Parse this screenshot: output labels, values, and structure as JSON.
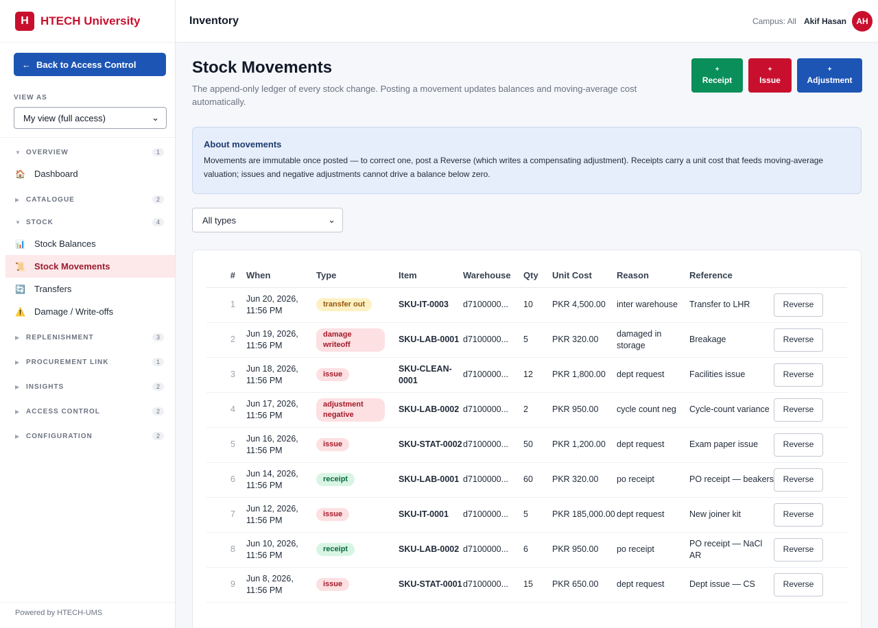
{
  "brand": {
    "logo_letter": "H",
    "name": "HTECH University",
    "color": "#c8102e"
  },
  "sidebar": {
    "back_label": "Back to Access Control",
    "view_as_label": "VIEW AS",
    "view_as_value": "My view (full access)",
    "groups": [
      {
        "name": "OVERVIEW",
        "count": "1",
        "expanded": true,
        "items": [
          {
            "icon": "house-icon",
            "label": "Dashboard"
          }
        ]
      },
      {
        "name": "CATALOGUE",
        "count": "2",
        "expanded": false
      },
      {
        "name": "STOCK",
        "count": "4",
        "expanded": true,
        "items": [
          {
            "icon": "bar-chart-icon",
            "label": "Stock Balances"
          },
          {
            "icon": "scroll-icon",
            "label": "Stock Movements",
            "active": true
          },
          {
            "icon": "transfer-icon",
            "label": "Transfers"
          },
          {
            "icon": "warning-icon",
            "label": "Damage / Write-offs"
          }
        ]
      },
      {
        "name": "REPLENISHMENT",
        "count": "3",
        "expanded": false
      },
      {
        "name": "PROCUREMENT LINK",
        "count": "1",
        "expanded": false
      },
      {
        "name": "INSIGHTS",
        "count": "2",
        "expanded": false
      },
      {
        "name": "ACCESS CONTROL",
        "count": "2",
        "expanded": false
      },
      {
        "name": "CONFIGURATION",
        "count": "2",
        "expanded": false
      }
    ],
    "powered_by": "Powered by HTECH-UMS"
  },
  "topbar": {
    "title": "Inventory",
    "campus": "Campus: All",
    "user_name": "Akif Hasan",
    "avatar_initials": "AH"
  },
  "page": {
    "title": "Stock Movements",
    "subtitle": "The append-only ledger of every stock change. Posting a movement updates balances and moving-average cost automatically.",
    "actions": [
      {
        "plus": "+",
        "label": "Receipt",
        "color": "#0a8f5a"
      },
      {
        "plus": "+",
        "label": "Issue",
        "color": "#c8102e"
      },
      {
        "plus": "+",
        "label": "Adjustment",
        "color": "#1d55b4"
      }
    ],
    "info": {
      "title": "About movements",
      "text": "Movements are immutable once posted — to correct one, post a Reverse (which writes a compensating adjustment). Receipts carry a unit cost that feeds moving-average valuation; issues and negative adjustments cannot drive a balance below zero."
    },
    "filter_value": "All types"
  },
  "table": {
    "headers": [
      "#",
      "When",
      "Type",
      "Item",
      "Warehouse",
      "Qty",
      "Unit Cost",
      "Reason",
      "Reference",
      ""
    ],
    "reverse_label": "Reverse",
    "rows": [
      {
        "n": "1",
        "when": "Jun 20, 2026, 11:56 PM",
        "type": "transfer out",
        "tclass": "b-transfer",
        "item": "SKU-IT-0003",
        "wh": "d7100000...",
        "qty": "10",
        "cost": "PKR 4,500.00",
        "reason": "inter warehouse",
        "ref": "Transfer to LHR"
      },
      {
        "n": "2",
        "when": "Jun 19, 2026, 11:56 PM",
        "type": "damage writeoff",
        "tclass": "b-damage b-wide",
        "item": "SKU-LAB-0001",
        "wh": "d7100000...",
        "qty": "5",
        "cost": "PKR 320.00",
        "reason": "damaged in storage",
        "ref": "Breakage"
      },
      {
        "n": "3",
        "when": "Jun 18, 2026, 11:56 PM",
        "type": "issue",
        "tclass": "b-issue",
        "item": "SKU-CLEAN-0001",
        "wh": "d7100000...",
        "qty": "12",
        "cost": "PKR 1,800.00",
        "reason": "dept request",
        "ref": "Facilities issue"
      },
      {
        "n": "4",
        "when": "Jun 17, 2026, 11:56 PM",
        "type": "adjustment negative",
        "tclass": "b-adjust b-wide",
        "item": "SKU-LAB-0002",
        "wh": "d7100000...",
        "qty": "2",
        "cost": "PKR 950.00",
        "reason": "cycle count neg",
        "ref": "Cycle-count variance"
      },
      {
        "n": "5",
        "when": "Jun 16, 2026, 11:56 PM",
        "type": "issue",
        "tclass": "b-issue",
        "item": "SKU-STAT-0002",
        "wh": "d7100000...",
        "qty": "50",
        "cost": "PKR 1,200.00",
        "reason": "dept request",
        "ref": "Exam paper issue"
      },
      {
        "n": "6",
        "when": "Jun 14, 2026, 11:56 PM",
        "type": "receipt",
        "tclass": "b-receipt",
        "item": "SKU-LAB-0001",
        "wh": "d7100000...",
        "qty": "60",
        "cost": "PKR 320.00",
        "reason": "po receipt",
        "ref": "PO receipt — beakers"
      },
      {
        "n": "7",
        "when": "Jun 12, 2026, 11:56 PM",
        "type": "issue",
        "tclass": "b-issue",
        "item": "SKU-IT-0001",
        "wh": "d7100000...",
        "qty": "5",
        "cost": "PKR 185,000.00",
        "reason": "dept request",
        "ref": "New joiner kit"
      },
      {
        "n": "8",
        "when": "Jun 10, 2026, 11:56 PM",
        "type": "receipt",
        "tclass": "b-receipt",
        "item": "SKU-LAB-0002",
        "wh": "d7100000...",
        "qty": "6",
        "cost": "PKR 950.00",
        "reason": "po receipt",
        "ref": "PO receipt — NaCl AR"
      },
      {
        "n": "9",
        "when": "Jun 8, 2026, 11:56 PM",
        "type": "issue",
        "tclass": "b-issue",
        "item": "SKU-STAT-0001",
        "wh": "d7100000...",
        "qty": "15",
        "cost": "PKR 650.00",
        "reason": "dept request",
        "ref": "Dept issue — CS"
      }
    ]
  }
}
